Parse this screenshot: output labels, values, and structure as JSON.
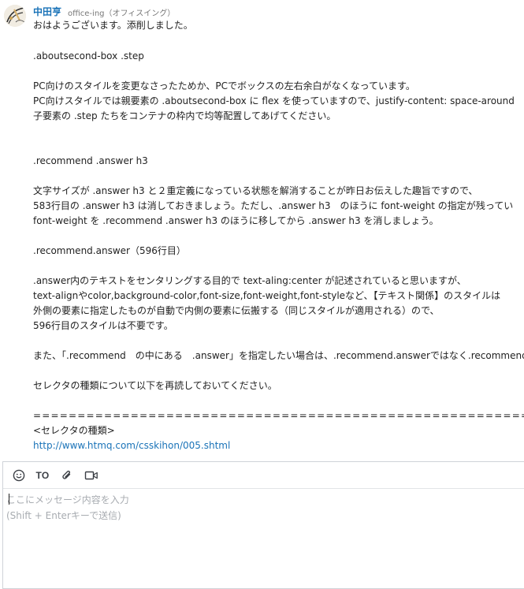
{
  "message": {
    "sender_name": "中田亨",
    "sender_org": "office-ing（オフィスイング）",
    "lines": [
      "おはようございます。添削しました。",
      ".aboutsecond-box .step",
      "PC向けのスタイルを変更なさったためか、PCでボックスの左右余白がなくなっています。",
      "PC向けスタイルでは親要素の .aboutsecond-box に flex を使っていますので、justify-content: space-around",
      "子要素の .step たちをコンテナの枠内で均等配置してあげてください。",
      ".recommend .answer h3",
      "文字サイズが .answer h3 と２重定義になっている状態を解消することが昨日お伝えした趣旨ですので、",
      "583行目の .answer h3 は消しておきましょう。ただし、.answer h3　のほうに font-weight の指定が残ってい",
      "font-weight を .recommend .answer h3 のほうに移してから .answer h3 を消しましょう。",
      ".recommend.answer（596行目）",
      ".answer内のテキストをセンタリングする目的で text-aling:center が記述されていると思いますが、",
      "text-alignやcolor,background-color,font-size,font-weight,font-styleなど、【テキスト関係】のスタイルは",
      "外側の要素に指定したものが自動で内側の要素に伝搬する（同じスタイルが適用される）ので、",
      "596行目のスタイルは不要です。",
      "また、「.recommend　の中にある　.answer」を指定したい場合は、.recommend.answerではなく.recommend",
      "セレクタの種類について以下を再読しておいてください。",
      "==================================================================",
      "<セレクタの種類>"
    ],
    "link": "http://www.htmq.com/csskihon/005.shtml"
  },
  "composer": {
    "placeholder": "ここにメッセージ内容を入力\n(Shift + Enterキーで送信)",
    "toolbar": {
      "emoji_icon": "smiley-icon",
      "to_label": "TO",
      "attach_icon": "paperclip-icon",
      "video_icon": "video-call-icon"
    }
  },
  "colors": {
    "accent": "#1a73b8",
    "text": "#222222",
    "placeholder": "#a8acb1",
    "border": "#cfd3d8"
  }
}
